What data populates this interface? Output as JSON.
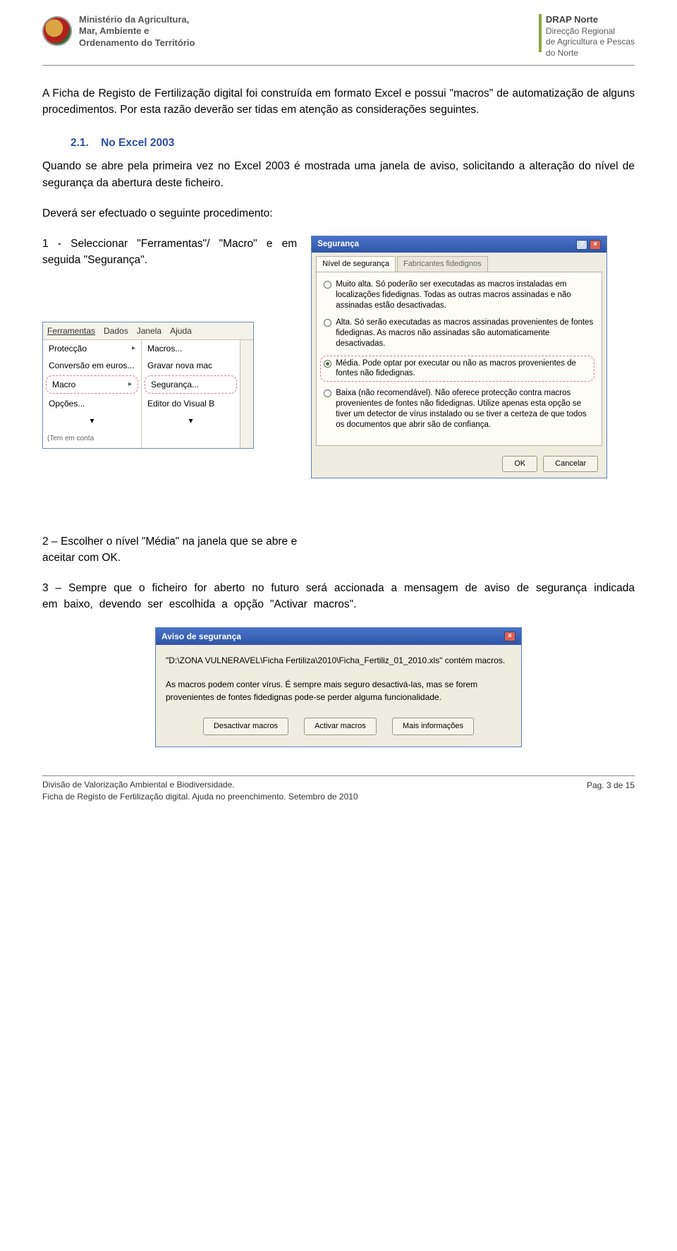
{
  "header": {
    "ministry_l1": "Ministério da Agricultura,",
    "ministry_l2": "Mar, Ambiente e",
    "ministry_l3": "Ordenamento do Território",
    "drap_title": "DRAP Norte",
    "drap_l1": "Direcção Regional",
    "drap_l2": "de Agricultura e Pescas",
    "drap_l3": "do Norte"
  },
  "intro": "A Ficha de Registo de Fertilização digital foi construída em formato Excel e possui \"macros\" de automatização de alguns procedimentos. Por esta razão deverão ser tidas em atenção as considerações seguintes.",
  "section": {
    "num": "2.1.",
    "title": "No Excel 2003"
  },
  "p1": "Quando se abre pela primeira vez no Excel 2003 é mostrada uma janela de aviso, solicitando a alteração do nível de segurança da abertura deste ficheiro.",
  "p2": "Deverá ser efectuado o seguinte procedimento:",
  "step1": "1 - Seleccionar \"Ferramentas\"/ \"Macro\" e em seguida \"Segurança\".",
  "step2": "2 – Escolher o nível \"Média\" na janela que se abre e aceitar com OK.",
  "step3": "3 – Sempre que o ficheiro for aberto no futuro será accionada a mensagem de aviso de segurança indicada em baixo, devendo ser escolhida a opção \"Activar macros\".",
  "excel_menu": {
    "bar": [
      "Ferramentas",
      "Dados",
      "Janela",
      "Ajuda"
    ],
    "col1": [
      "Protecção",
      "Conversão em euros...",
      "Macro",
      "Opções..."
    ],
    "col2": [
      "Macros...",
      "Gravar nova mac",
      "Segurança...",
      "Editor do Visual B"
    ],
    "note": "(Tem em conta"
  },
  "security_dialog": {
    "title": "Segurança",
    "tab1": "Nível de segurança",
    "tab2": "Fabricantes fidedignos",
    "opt_muito_alto": "Muito alta. Só poderão ser executadas as macros instaladas em localizações fidedignas. Todas as outras macros assinadas e não assinadas estão desactivadas.",
    "opt_alto": "Alta. Só serão executadas as macros assinadas provenientes de fontes fidedignas. As macros não assinadas são automaticamente desactivadas.",
    "opt_media": "Média. Pode optar por executar ou não as macros provenientes de fontes não fidedignas.",
    "opt_baixa": "Baixa (não recomendável). Não oferece protecção contra macros provenientes de fontes não fidedignas. Utilize apenas esta opção se tiver um detector de vírus instalado ou se tiver a certeza de que todos os documentos que abrir são de confiança.",
    "ok": "OK",
    "cancel": "Cancelar"
  },
  "warning_dialog": {
    "title": "Aviso de segurança",
    "path": "\"D:\\ZONA VULNERAVEL\\Ficha Fertiliza\\2010\\Ficha_Fertiliz_01_2010.xls\" contém macros.",
    "msg": "As macros podem conter vírus. É sempre mais seguro desactivá-las, mas se forem provenientes de fontes fidedignas pode-se perder alguma funcionalidade.",
    "btn1": "Desactivar macros",
    "btn2": "Activar macros",
    "btn3": "Mais informações"
  },
  "footer": {
    "l1": "Divisão de Valorização Ambiental e Biodiversidade.",
    "l2": "Ficha de Registo de Fertilização digital. Ajuda no preenchimento. Setembro de 2010",
    "page": "Pag. 3 de 15"
  }
}
